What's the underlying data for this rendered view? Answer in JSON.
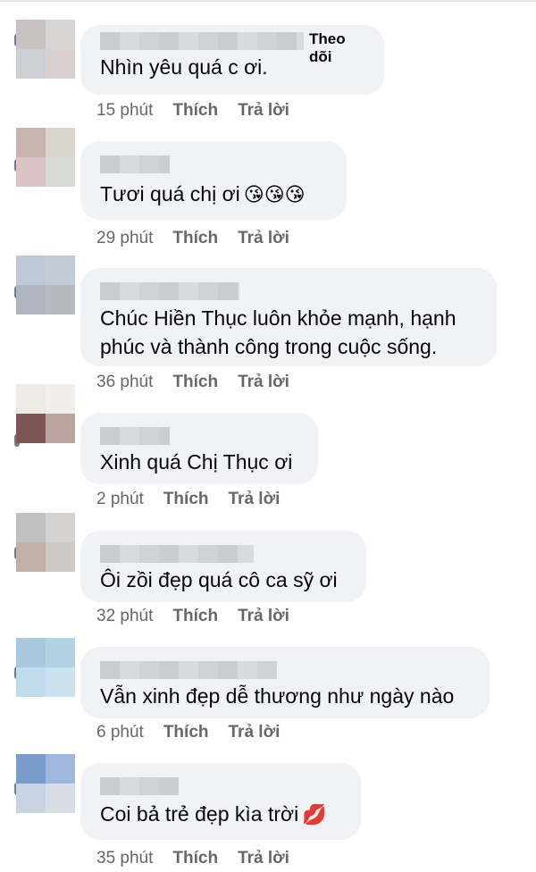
{
  "comments": [
    {
      "follow": "Theo dõi",
      "text": "Nhìn yêu quá c ơi.",
      "emoji": "",
      "time": "15 phút",
      "like": "Thích",
      "reply": "Trả lời"
    },
    {
      "text": "Tươi quá chị ơi",
      "emoji": "😘😘😘",
      "time": "29 phút",
      "like": "Thích",
      "reply": "Trả lời"
    },
    {
      "text": "Chúc Hiền Thục luôn khỏe mạnh, hạnh phúc và thành công trong cuộc sống.",
      "emoji": "",
      "time": "36 phút",
      "like": "Thích",
      "reply": "Trả lời"
    },
    {
      "text": "Xinh quá Chị Thục ơi",
      "emoji": "",
      "time": "2 phút",
      "like": "Thích",
      "reply": "Trả lời"
    },
    {
      "text": "Ôi zồi đẹp quá cô ca sỹ ơi",
      "emoji": "",
      "time": "32 phút",
      "like": "Thích",
      "reply": "Trả lời"
    },
    {
      "text": "Vẫn xinh đẹp dễ thương như ngày nào",
      "emoji": "",
      "time": "6 phút",
      "like": "Thích",
      "reply": "Trả lời"
    },
    {
      "text": "Coi bả trẻ đẹp kìa trời",
      "emoji": "💋",
      "time": "35 phút",
      "like": "Thích",
      "reply": "Trả lời"
    }
  ]
}
